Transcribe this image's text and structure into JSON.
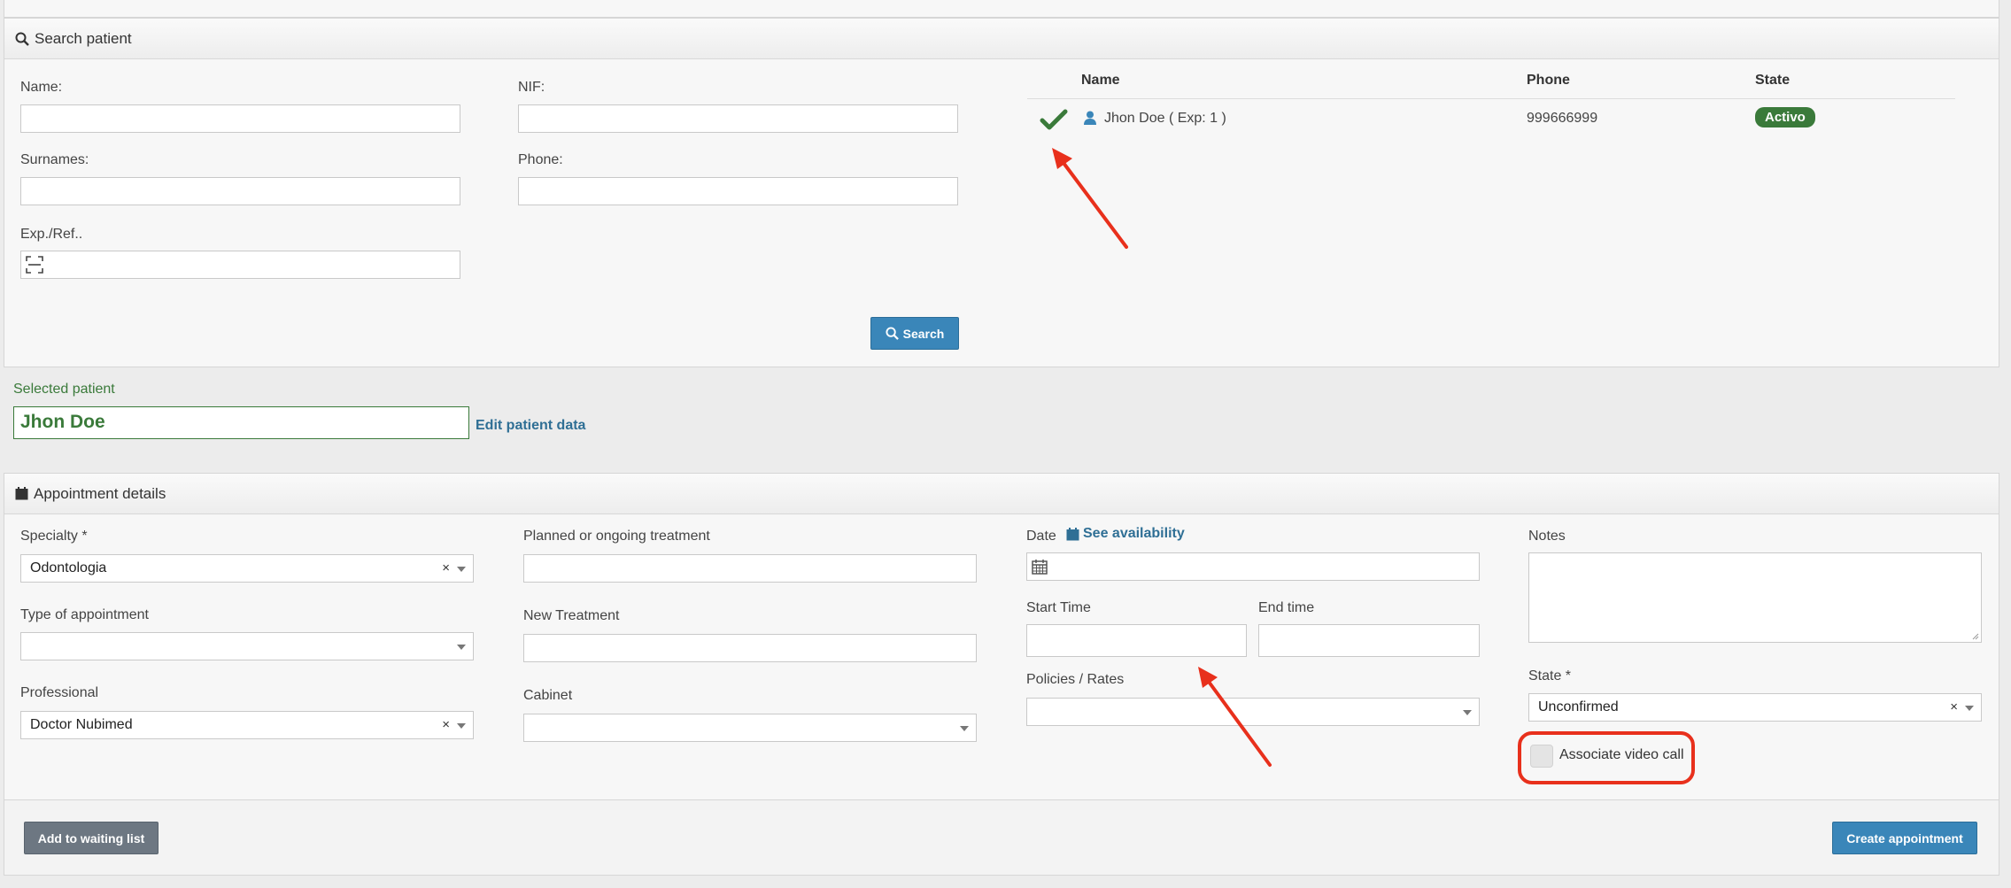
{
  "search_panel": {
    "title": "Search patient",
    "name_label": "Name:",
    "nif_label": "NIF:",
    "surnames_label": "Surnames:",
    "phone_label": "Phone:",
    "exp_label": "Exp./Ref..",
    "search_button": "Search",
    "results": {
      "headers": [
        "Name",
        "Phone",
        "State"
      ],
      "rows": [
        {
          "name": "Jhon Doe ( Exp: 1 )",
          "phone": "999666999",
          "state": "Activo"
        }
      ]
    }
  },
  "selected_patient": {
    "label": "Selected patient",
    "value": "Jhon Doe",
    "edit_link": "Edit patient data"
  },
  "appointment_panel": {
    "title": "Appointment details",
    "specialty_label": "Specialty *",
    "specialty_value": "Odontologia",
    "type_label": "Type of appointment",
    "type_value": "",
    "professional_label": "Professional",
    "professional_value": "Doctor Nubimed",
    "planned_label": "Planned or ongoing treatment",
    "new_treatment_label": "New Treatment",
    "cabinet_label": "Cabinet",
    "date_label": "Date",
    "see_availability": "See availability",
    "start_time_label": "Start Time",
    "end_time_label": "End time",
    "policies_label": "Policies / Rates",
    "notes_label": "Notes",
    "state_label": "State *",
    "state_value": "Unconfirmed",
    "video_call_label": "Associate video call",
    "clear_symbol": "×"
  },
  "footer": {
    "waiting_list_button": "Add to waiting list",
    "create_button": "Create appointment"
  },
  "colors": {
    "primary": "#3a86b9",
    "success": "#3a7a3a",
    "annotation": "#e8301c"
  }
}
